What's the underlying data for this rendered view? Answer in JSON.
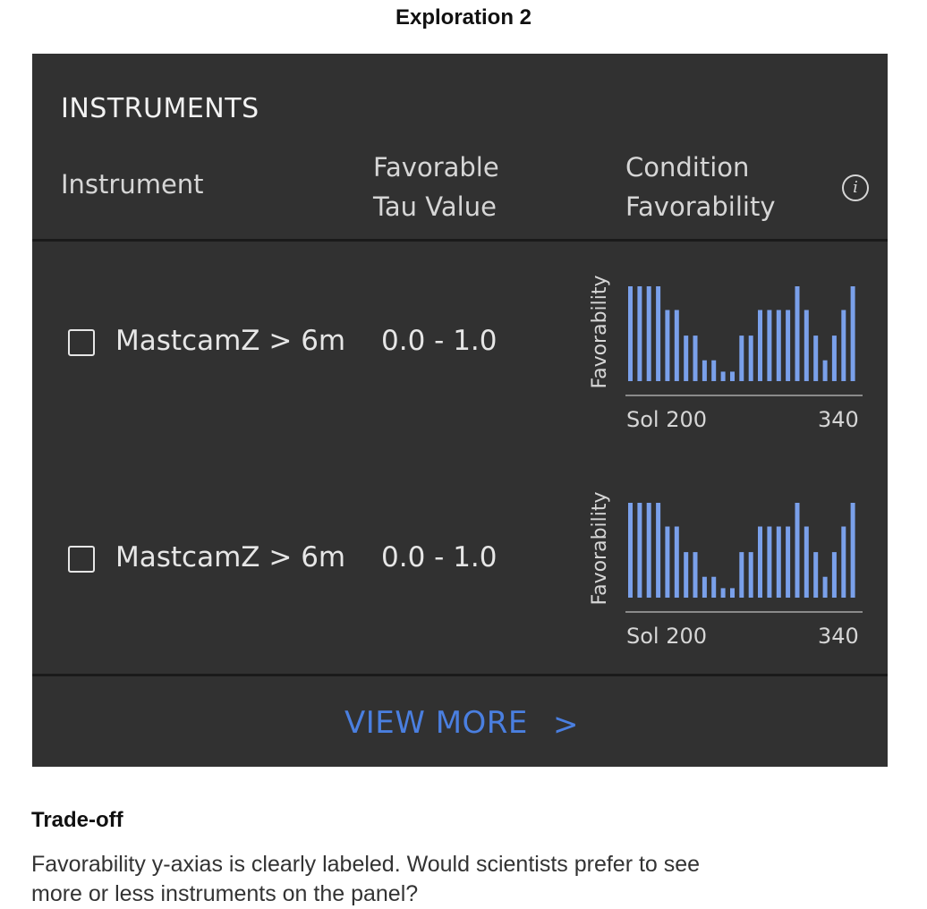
{
  "page": {
    "title": "Exploration 2"
  },
  "panel": {
    "title": "INSTRUMENTS",
    "columns": {
      "instrument": "Instrument",
      "tau": [
        "Favorable",
        "Tau Value"
      ],
      "condition": [
        "Condition",
        "Favorability"
      ]
    },
    "info_icon": "i",
    "view_more": "VIEW MORE",
    "chevron": ">"
  },
  "rows": [
    {
      "label": "MastcamZ > 6m",
      "tau": "0.0 - 1.0",
      "checked": false,
      "chart_ylabel": "Favorability",
      "x_start": "Sol 200",
      "x_end": "340"
    },
    {
      "label": "MastcamZ > 6m",
      "tau": "0.0 - 1.0",
      "checked": false,
      "chart_ylabel": "Favorability",
      "x_start": "Sol 200",
      "x_end": "340"
    }
  ],
  "chart_data": [
    {
      "type": "bar",
      "ylabel": "Favorability",
      "xlabel": "",
      "x_tick_labels": [
        "Sol 200",
        "340"
      ],
      "values": [
        1.0,
        1.0,
        1.0,
        1.0,
        0.75,
        0.75,
        0.48,
        0.48,
        0.22,
        0.22,
        0.1,
        0.1,
        0.48,
        0.48,
        0.75,
        0.75,
        0.75,
        0.75,
        1.0,
        0.75,
        0.48,
        0.22,
        0.48,
        0.75,
        1.0
      ],
      "bar_color": "#7aa0ea",
      "axis_color": "#8a8a8a"
    },
    {
      "type": "bar",
      "ylabel": "Favorability",
      "xlabel": "",
      "x_tick_labels": [
        "Sol 200",
        "340"
      ],
      "values": [
        1.0,
        1.0,
        1.0,
        1.0,
        0.75,
        0.75,
        0.48,
        0.48,
        0.22,
        0.22,
        0.1,
        0.1,
        0.48,
        0.48,
        0.75,
        0.75,
        0.75,
        0.75,
        1.0,
        0.75,
        0.48,
        0.22,
        0.48,
        0.75,
        1.0
      ],
      "bar_color": "#7aa0ea",
      "axis_color": "#8a8a8a"
    }
  ],
  "tradeoff": {
    "title": "Trade-off",
    "text": "Favorability y-axias is clearly labeled. Would scientists prefer to see more or less instruments on the panel?"
  }
}
